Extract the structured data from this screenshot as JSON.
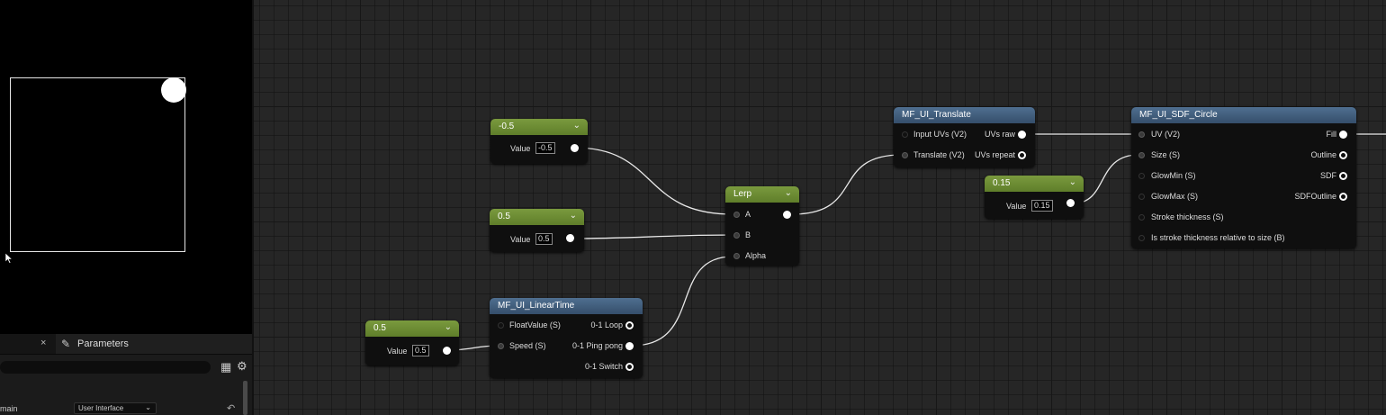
{
  "preview": {},
  "bottom_panel": {
    "tab_close": "×",
    "params_tab": "Parameters",
    "detail_row_name": "main",
    "domain_value": "User Interface",
    "dropdown_chevron": "⌄",
    "reset_glyph": "↶"
  },
  "graph": {
    "const1": {
      "title": "-0.5",
      "value_label": "Value",
      "value": "-0.5"
    },
    "const2": {
      "title": "0.5",
      "value_label": "Value",
      "value": "0.5"
    },
    "const3": {
      "title": "0.5",
      "value_label": "Value",
      "value": "0.5"
    },
    "const4": {
      "title": "0.15",
      "value_label": "Value",
      "value": "0.15"
    },
    "lerp": {
      "title": "Lerp",
      "pins": [
        "A",
        "B",
        "Alpha"
      ]
    },
    "linear_time": {
      "title": "MF_UI_LinearTime",
      "inputs": [
        "FloatValue (S)",
        "Speed (S)"
      ],
      "outputs": [
        "0-1 Loop",
        "0-1 Ping pong",
        "0-1 Switch"
      ]
    },
    "translate": {
      "title": "MF_UI_Translate",
      "inputs": [
        "Input UVs (V2)",
        "Translate (V2)"
      ],
      "outputs": [
        "UVs raw",
        "UVs repeat"
      ]
    },
    "sdf_circle": {
      "title": "MF_UI_SDF_Circle",
      "inputs": [
        "UV (V2)",
        "Size (S)",
        "GlowMin (S)",
        "GlowMax (S)",
        "Stroke thickness (S)",
        "Is stroke thickness relative to size (B)"
      ],
      "outputs": [
        "Fill",
        "Outline",
        "SDF",
        "SDFOutline"
      ]
    }
  },
  "icons": [
    "close-icon",
    "pencil-icon",
    "grid-icon",
    "gear-icon",
    "chevron-down-icon",
    "reset-icon",
    "mouse-cursor-icon"
  ],
  "colors": {
    "constant_header": "#6b8b33",
    "function_header": "#446384",
    "graph_background": "#262626",
    "wire": "#e6e6e6"
  }
}
